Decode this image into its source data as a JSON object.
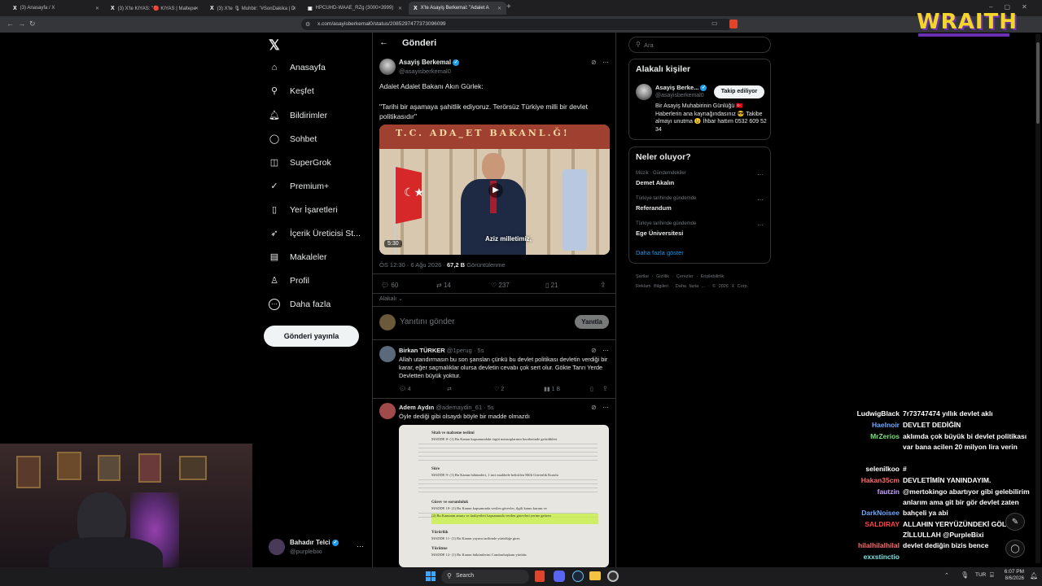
{
  "browser": {
    "tabs": [
      {
        "label": "(3) Anasayfa / X"
      },
      {
        "label": "(3) X'te KIYAS: \"🔴 KIYAS | Maltepe"
      },
      {
        "label": "(3) X'te 🎙 Muhbir: \"#SonDakika | D"
      },
      {
        "label": "HPCUHD-WAAE_RZg (3000×3999)"
      },
      {
        "label": "X'te Asayiş Berkemal: \"Adalet A"
      }
    ],
    "url": "x.com/asayisberkemal0/status/2085297477373096099"
  },
  "overlay": {
    "streamer_logo": "WRAITH"
  },
  "nav": {
    "items": [
      {
        "label": "Anasayfa",
        "icon": "home-icon",
        "glyph": "⌂"
      },
      {
        "label": "Keşfet",
        "icon": "search-icon",
        "glyph": "⚲"
      },
      {
        "label": "Bildirimler",
        "icon": "bell-icon",
        "glyph": "♫"
      },
      {
        "label": "Sohbet",
        "icon": "chat-icon",
        "glyph": "◯"
      },
      {
        "label": "SuperGrok",
        "icon": "grok-icon",
        "glyph": "◫"
      },
      {
        "label": "Premium+",
        "icon": "premium-icon",
        "glyph": "✓"
      },
      {
        "label": "Yer İşaretleri",
        "icon": "bookmark-icon",
        "glyph": "▯"
      },
      {
        "label": "İçerik Üreticisi St...",
        "icon": "rocket-icon",
        "glyph": "➶"
      },
      {
        "label": "Makaleler",
        "icon": "articles-icon",
        "glyph": "▤"
      },
      {
        "label": "Profil",
        "icon": "profile-icon",
        "glyph": "♙"
      },
      {
        "label": "Daha fazla",
        "icon": "more-icon",
        "glyph": "⋯"
      }
    ],
    "post_button": "Gönderi yayınla",
    "account": {
      "name": "Bahadır Telci",
      "handle": "@purplebixi"
    }
  },
  "post": {
    "header_title": "Gönderi",
    "author_name": "Asayiş Berkemal",
    "author_handle": "@asayisberkemal0",
    "text_line1": "Adalet Adalet Bakanı Akın Gürlek:",
    "text_quote": "\"Tarihi bir aşamaya şahitlik ediyoruz. Terörsüz Türkiye milli bir devlet politikasıdır\"",
    "video_sign": "T.C. ADA_ET BAKANL.Ğ!",
    "video_caption": "Aziz milletimiz,",
    "video_duration": "5:30",
    "meta_time": "ÖS 12:30 · 6 Ağu 2026 ·",
    "meta_views_value": "67,2 B",
    "meta_views_label": "Görüntülenme",
    "stats": {
      "replies": "60",
      "reposts": "14",
      "likes": "237",
      "bookmarks": "21"
    },
    "sort_label": "Alakalı ⌄",
    "reply_placeholder": "Yanıtını gönder",
    "reply_button": "Yanıtla"
  },
  "replies": [
    {
      "name": "Birkan TÜRKER",
      "handle": "@1perug · 5s",
      "text": "Allah utandırmasın bu son şanslan çünkü bu devlet politikası devletin verdiği bir karar, eğer saçmalıklar olursa devletin cevabı çok sert olur. Gökte Tanrı Yerde Devletten büyük yoktur.",
      "stats": {
        "replies": "4",
        "reposts": "",
        "likes": "2",
        "views": "1 B"
      }
    },
    {
      "name": "Adem Aydın",
      "handle": "@ademaydin_61 · 5s",
      "text": "Öyle dediği gibi olsaydı böyle bir madde olmazdı"
    }
  ],
  "document": {
    "lines": [
      "Sitah ve malzeme teslimi",
      "MADDE 8- (1) Bu Kanun kapsamındaki örgüt mensuplarının beraberinde getirdikleri",
      "Süre",
      "MADDE 9- (1) Bu Kanun hükümleri, 1 inci maddede belirtilen Milli Güvenlik Kurulu",
      "Görev ve sorumluluk",
      "MADDE 10- (1) Bu Kanun kapsamında verilen görevler, ilgili kamu kurum ve",
      "(2) Bu Kanunun amacı ve faaliyetleri kapsamında verilen görevleri yerine getiren",
      "Yürürlük",
      "MADDE 11- (1) Bu Kanun yayımı tarihinde yürürlüğe girer.",
      "Yürütme",
      "MADDE 12- (1) Bu Kanun hükümlerini Cumhurbaşkanı yürütür."
    ]
  },
  "search": {
    "placeholder": "Ara"
  },
  "related": {
    "title": "Alakalı kişiler",
    "name": "Asayiş Berke...",
    "handle": "@asayisberkemal0",
    "follow_label": "Takip ediliyor",
    "bio": "Bir Asayiş Muhabirinin Günlüğü 🇹🇷 Haberlerin ana kaynağındasınız 😎 Takibe almayı unutma 😉 İhbar hattım 0532 609 52 34"
  },
  "trends": {
    "title": "Neler oluyor?",
    "items": [
      {
        "context": "Müzik · Gündemdekiler",
        "name": "Demet Akalın"
      },
      {
        "context": "Türkiye tarihinde gündemde",
        "name": "Referandum"
      },
      {
        "context": "Türkiye tarihinde gündemde",
        "name": "Ege Üniversitesi"
      }
    ],
    "show_more": "Daha fazla göster"
  },
  "footer_links": [
    "Şartlar",
    "Gizlilik",
    "Çerezler",
    "Erişilebilirlik",
    "Reklam Bilgileri",
    "Daha fazla ...",
    "© 2026 X Corp."
  ],
  "chat": [
    {
      "user": "LudwigBlack",
      "color": "#ffffff",
      "msg": "7r73747474 yıllık devlet aklı"
    },
    {
      "user": "HaeInoir",
      "color": "#6fa8ff",
      "msg": "DEVLET DEDİĞİN"
    },
    {
      "user": "MrZerios",
      "color": "#7be37b",
      "msg": "aklımda çok büyük bi devlet politikası var bana acilen 20 milyon lira verin"
    },
    {
      "user": "selenilkoo",
      "color": "#ffffff",
      "msg": "#"
    },
    {
      "user": "Hakan35cm",
      "color": "#ff6b6b",
      "msg": "DEVLETİMİN YANINDAYIM."
    },
    {
      "user": "fautzin",
      "color": "#c7a2ff",
      "msg": "@mertokingo abartıyor gibi gelebilirim anlarım ama git bir gör devlet zaten bahçeli ya abi"
    },
    {
      "user": "DarkNoisee",
      "color": "#6fa8ff",
      "msg": ""
    },
    {
      "user": "SALDIRAY",
      "color": "#ff4444",
      "msg": "ALLAHIN YERYÜZÜNDEKİ GÖLGESİ ZİLLULLAH @PurpleBixi"
    },
    {
      "user": "hilalhilalhilal",
      "color": "#ff6b6b",
      "msg": "devlet dediğin bizis bence"
    },
    {
      "user": "exxstinctio",
      "color": "#7be3e3",
      "msg": ""
    }
  ],
  "taskbar": {
    "search_label": "Search",
    "lang": "TUR",
    "time": "6:07 PM",
    "date": "8/6/2026"
  }
}
